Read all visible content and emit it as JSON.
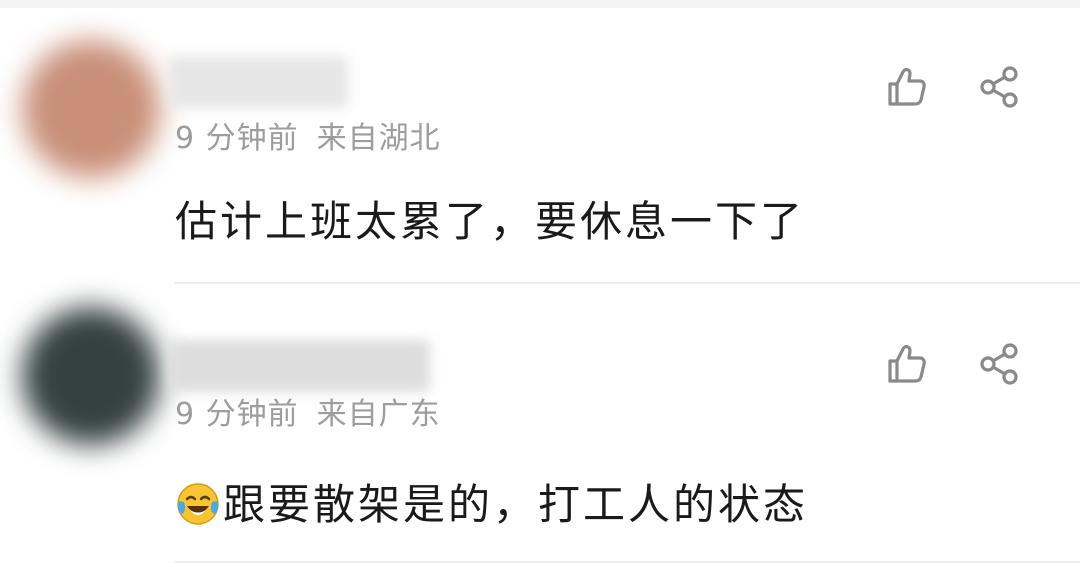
{
  "comments": [
    {
      "time": "9 分钟前",
      "location": "来自湖北",
      "text": "估计上班太累了，要休息一下了",
      "avatar_color": "#c98f78",
      "username_blur_color": "#e6e6e6",
      "emoji": ""
    },
    {
      "time": "9 分钟前",
      "location": "来自广东",
      "text": "跟要散架是的，打工人的状态",
      "avatar_color": "#34413f",
      "username_blur_color": "#dddddd",
      "emoji": "tears-of-joy-emoji"
    }
  ],
  "icons": {
    "like": "thumbs-up-icon",
    "share": "share-icon"
  },
  "colors": {
    "meta_text": "#9d9d9d",
    "body_text": "#1a1a1a",
    "icon_stroke": "#8a8a8a",
    "divider": "#ededed"
  }
}
